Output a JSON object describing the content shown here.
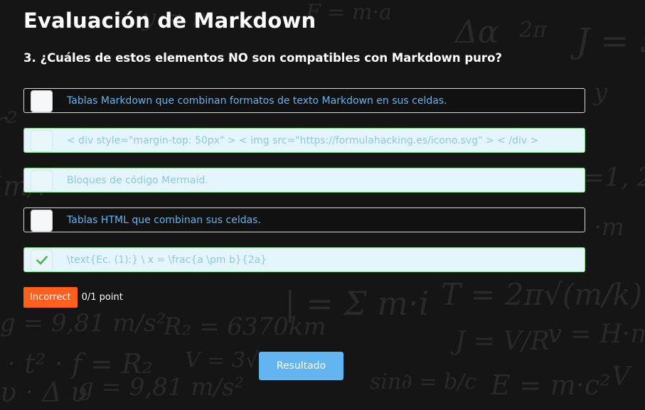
{
  "page": {
    "title": "Evaluación de Markdown"
  },
  "question": {
    "text": "3. ¿Cuáles de estos elementos NO son compatibles con Markdown puro?"
  },
  "options": [
    {
      "label": "Tablas Markdown que combinan formatos de texto Markdown en sus celdas.",
      "checked": false,
      "style": "dark"
    },
    {
      "label": "< div style=\"margin-top: 50px\" > < img src=\"https://formulahacking.es/icono.svg\" > < /div >",
      "checked": false,
      "style": "light"
    },
    {
      "label": "Bloques de código Mermaid.",
      "checked": false,
      "style": "light"
    },
    {
      "label": "Tablas HTML que combinan sus celdas.",
      "checked": false,
      "style": "dark"
    },
    {
      "label": "\\text{Ec. (1):} \\ x = \\frac{a \\pm b}{2a}",
      "checked": true,
      "style": "light"
    }
  ],
  "result": {
    "badge": "Incorrect",
    "points": "0/1 point"
  },
  "submit": {
    "label": "Resultado"
  },
  "colors": {
    "background": "#151515",
    "badge": "#ff5f1f",
    "button": "#62b5f0",
    "correct_border": "#7fd88a",
    "check_mark": "#45b35a"
  }
}
